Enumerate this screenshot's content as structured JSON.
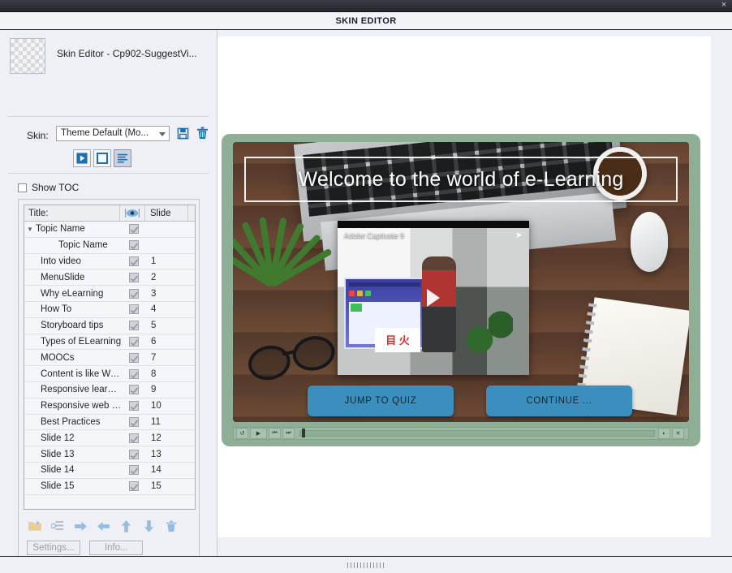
{
  "window": {
    "title": "SKIN EDITOR",
    "close_label": "×"
  },
  "left_panel": {
    "project_title": "Skin Editor - Cp902-SuggestVi...",
    "thumbnail_name": "project-thumbnail",
    "skin": {
      "label": "Skin:",
      "selected": "Theme Default (Mo...",
      "save_icon": "save-icon",
      "delete_icon": "trash-icon"
    },
    "toggles": [
      {
        "name": "playback-controls-tab",
        "icon": "play-icon",
        "active": false
      },
      {
        "name": "borders-tab",
        "icon": "square-icon",
        "active": false
      },
      {
        "name": "table-of-contents-tab",
        "icon": "list-lines-icon",
        "active": true
      }
    ],
    "show_toc": {
      "label": "Show TOC",
      "checked": false
    },
    "toc_header": {
      "title": "Title:",
      "eye_icon": "eye-icon",
      "slide": "Slide"
    },
    "toc_rows": [
      {
        "title": "Topic Name",
        "slide": "",
        "indent": 0,
        "twisty": "▼",
        "checked": true
      },
      {
        "title": "Topic Name",
        "slide": "",
        "indent": 2,
        "twisty": "",
        "checked": true
      },
      {
        "title": "Into video",
        "slide": "1",
        "indent": 1,
        "twisty": "",
        "checked": true
      },
      {
        "title": "MenuSlide",
        "slide": "2",
        "indent": 1,
        "twisty": "",
        "checked": true
      },
      {
        "title": "Why eLearning",
        "slide": "3",
        "indent": 1,
        "twisty": "",
        "checked": true
      },
      {
        "title": "How To",
        "slide": "4",
        "indent": 1,
        "twisty": "",
        "checked": true
      },
      {
        "title": "Storyboard tips",
        "slide": "5",
        "indent": 1,
        "twisty": "",
        "checked": true
      },
      {
        "title": "Types of ELearning",
        "slide": "6",
        "indent": 1,
        "twisty": "",
        "checked": true
      },
      {
        "title": "MOOCs",
        "slide": "7",
        "indent": 1,
        "twisty": "",
        "checked": true
      },
      {
        "title": "Content is like Water",
        "slide": "8",
        "indent": 1,
        "twisty": "",
        "checked": true
      },
      {
        "title": "Responsive learning",
        "slide": "9",
        "indent": 1,
        "twisty": "",
        "checked": true
      },
      {
        "title": "Responsive web d...",
        "slide": "10",
        "indent": 1,
        "twisty": "",
        "checked": true
      },
      {
        "title": "Best Practices",
        "slide": "11",
        "indent": 1,
        "twisty": "",
        "checked": true
      },
      {
        "title": "Slide 12",
        "slide": "12",
        "indent": 1,
        "twisty": "",
        "checked": true
      },
      {
        "title": "Slide 13",
        "slide": "13",
        "indent": 1,
        "twisty": "",
        "checked": true
      },
      {
        "title": "Slide 14",
        "slide": "14",
        "indent": 1,
        "twisty": "",
        "checked": true
      },
      {
        "title": "Slide 15",
        "slide": "15",
        "indent": 1,
        "twisty": "",
        "checked": true
      }
    ],
    "toc_tools": [
      {
        "name": "new-folder-icon"
      },
      {
        "name": "topic-properties-icon"
      },
      {
        "name": "arrow-right-icon"
      },
      {
        "name": "arrow-left-icon"
      },
      {
        "name": "arrow-up-icon"
      },
      {
        "name": "arrow-down-icon"
      },
      {
        "name": "trash-icon"
      }
    ],
    "buttons": {
      "settings": "Settings...",
      "info": "Info..."
    }
  },
  "preview": {
    "slide_title": "Welcome to the world of e-Learning",
    "video": {
      "caption": "Adobe Captivate 9",
      "share_icon": "share-arrow-icon",
      "play_icon": "play-triangle-icon",
      "card_glyphs": "目 火"
    },
    "buttons": {
      "jump_to_quiz": "JUMP TO QUIZ",
      "continue": "CONTINUE ..."
    },
    "playbar": {
      "rewind": "↺",
      "play": "▶",
      "previous": "⏮",
      "next": "⏭",
      "audio": "◐",
      "close": "✕"
    }
  },
  "colors": {
    "accent_blue": "#3b8fbe",
    "stage_green": "#8fae96",
    "chrome_dark": "#24262c",
    "panel_bg": "#eef0f5"
  }
}
